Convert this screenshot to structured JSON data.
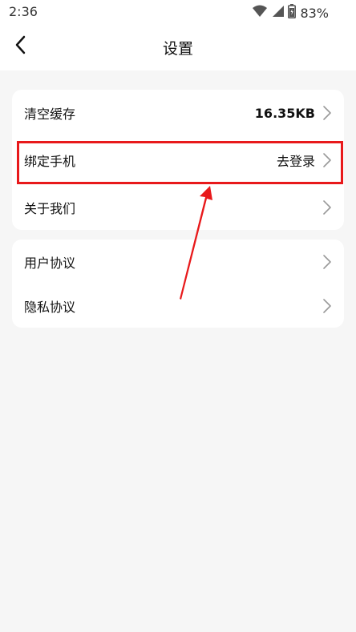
{
  "status_bar": {
    "time": "2:36",
    "battery": "83%",
    "icons": [
      "wifi-icon",
      "signal-icon",
      "battery-icon"
    ]
  },
  "navbar": {
    "title": "设置",
    "back_icon": "chevron-left-icon"
  },
  "settings_groups": [
    {
      "items": [
        {
          "label": "清空缓存",
          "value": "16.35KB"
        },
        {
          "label": "绑定手机",
          "value": "去登录"
        },
        {
          "label": "关于我们",
          "value": ""
        }
      ]
    },
    {
      "items": [
        {
          "label": "用户协议",
          "value": ""
        },
        {
          "label": "隐私协议",
          "value": ""
        }
      ]
    }
  ],
  "annotation": {
    "color": "#e8191b",
    "target": "绑定手机"
  }
}
